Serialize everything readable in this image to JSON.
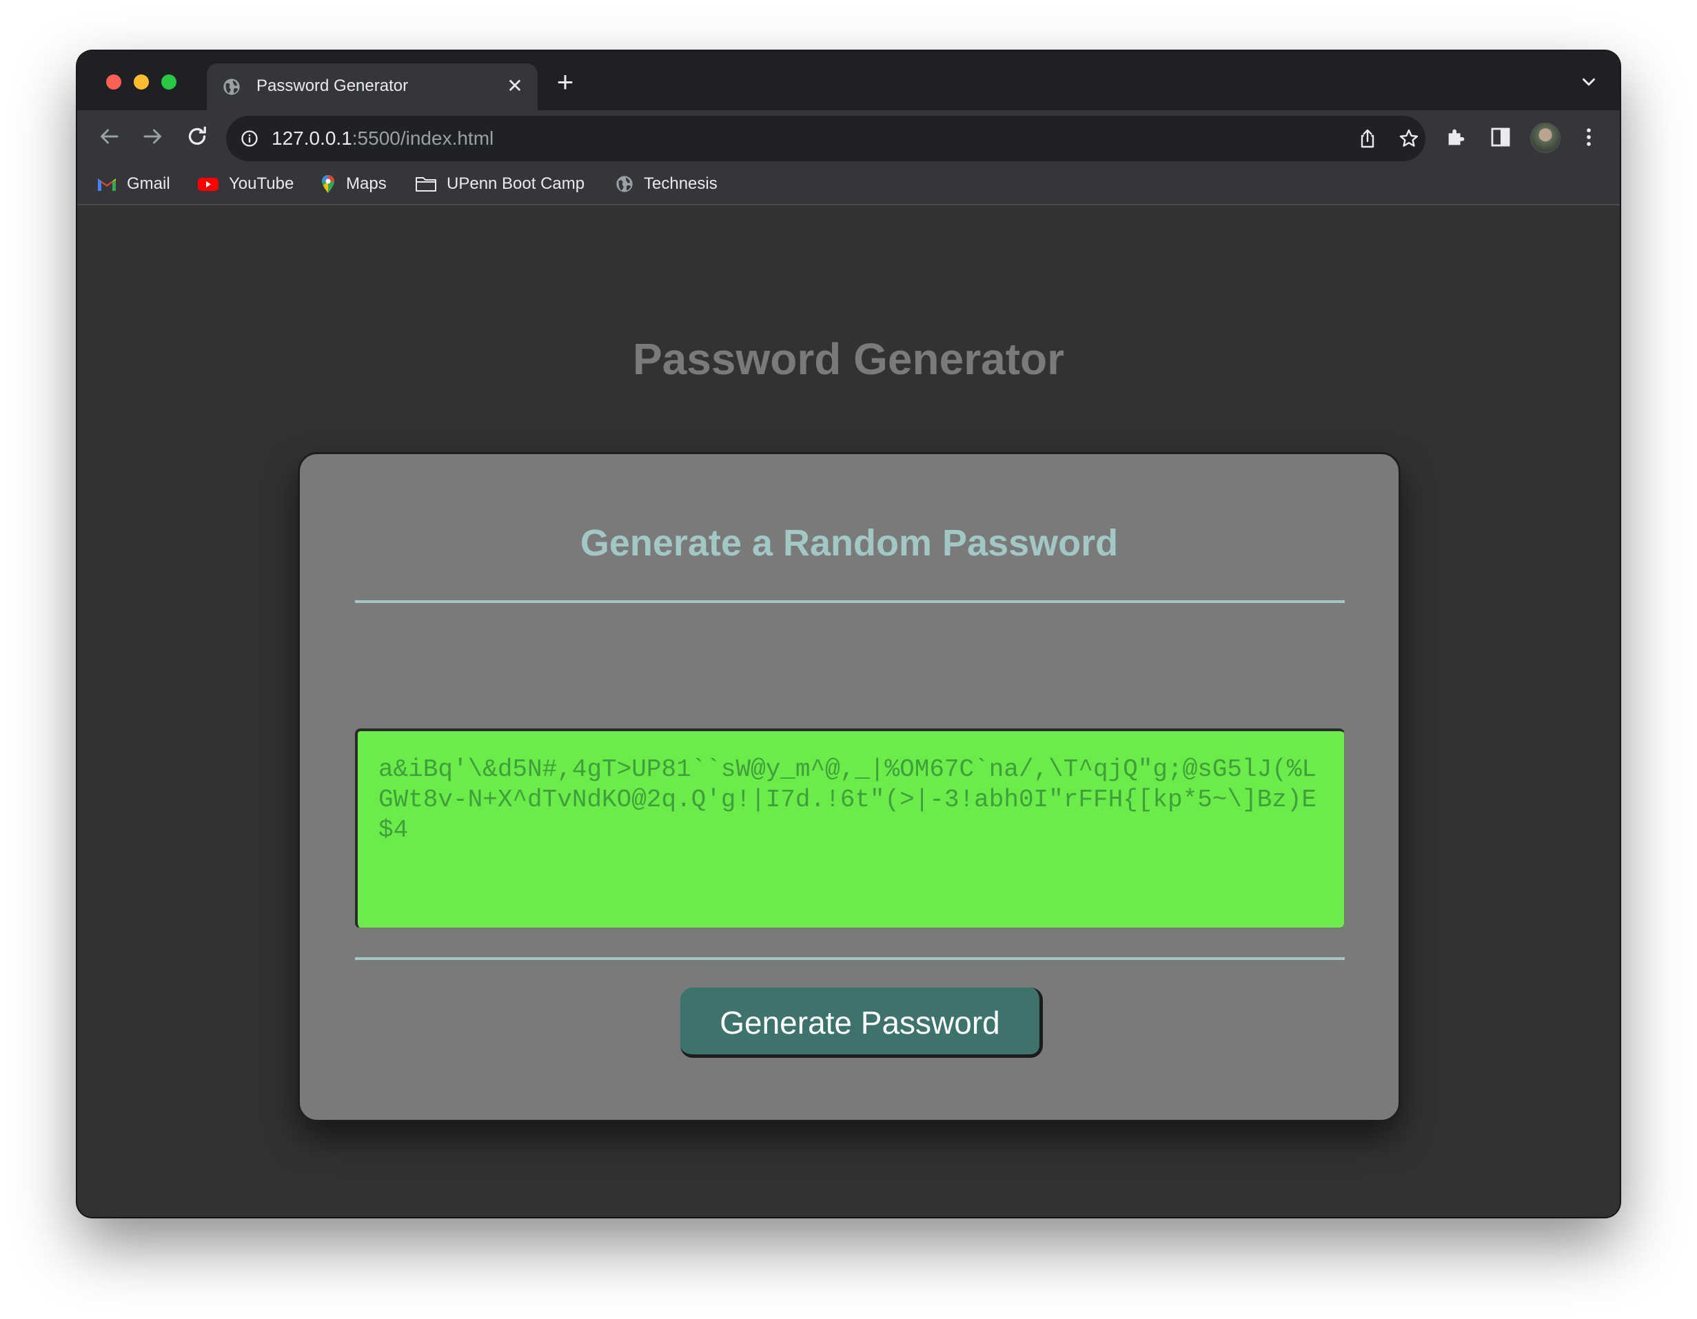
{
  "browser": {
    "tab_title": "Password Generator",
    "url_host": "127.0.0.1",
    "url_rest": ":5500/index.html",
    "bookmarks": [
      {
        "label": "Gmail",
        "icon": "gmail-icon"
      },
      {
        "label": "YouTube",
        "icon": "youtube-icon"
      },
      {
        "label": "Maps",
        "icon": "maps-icon"
      },
      {
        "label": "UPenn Boot Camp",
        "icon": "folder-icon"
      },
      {
        "label": "Technesis",
        "icon": "globe-icon"
      }
    ]
  },
  "page": {
    "title": "Password Generator",
    "card_header": "Generate a Random Password",
    "password": "a&iBq'\\&d5N#,4gT>UP81``sW@y_m^@,_|%OM67C`na/,\\T^qjQ\"g;@sG5lJ(%LGWt8v-N+X^dTvNdKO@2q.Q'g!|I7d.!6t\"(>|-3!abh0I\"rFFH{[kp*5~\\]Bz)E$4",
    "button_label": "Generate Password"
  },
  "colors": {
    "page_background": "#323233",
    "card_background": "#7a7a7a",
    "accent": "#a3c7c5",
    "password_background": "#6cec4b",
    "password_text": "#3f9f3a",
    "button_background": "#3e736d"
  }
}
